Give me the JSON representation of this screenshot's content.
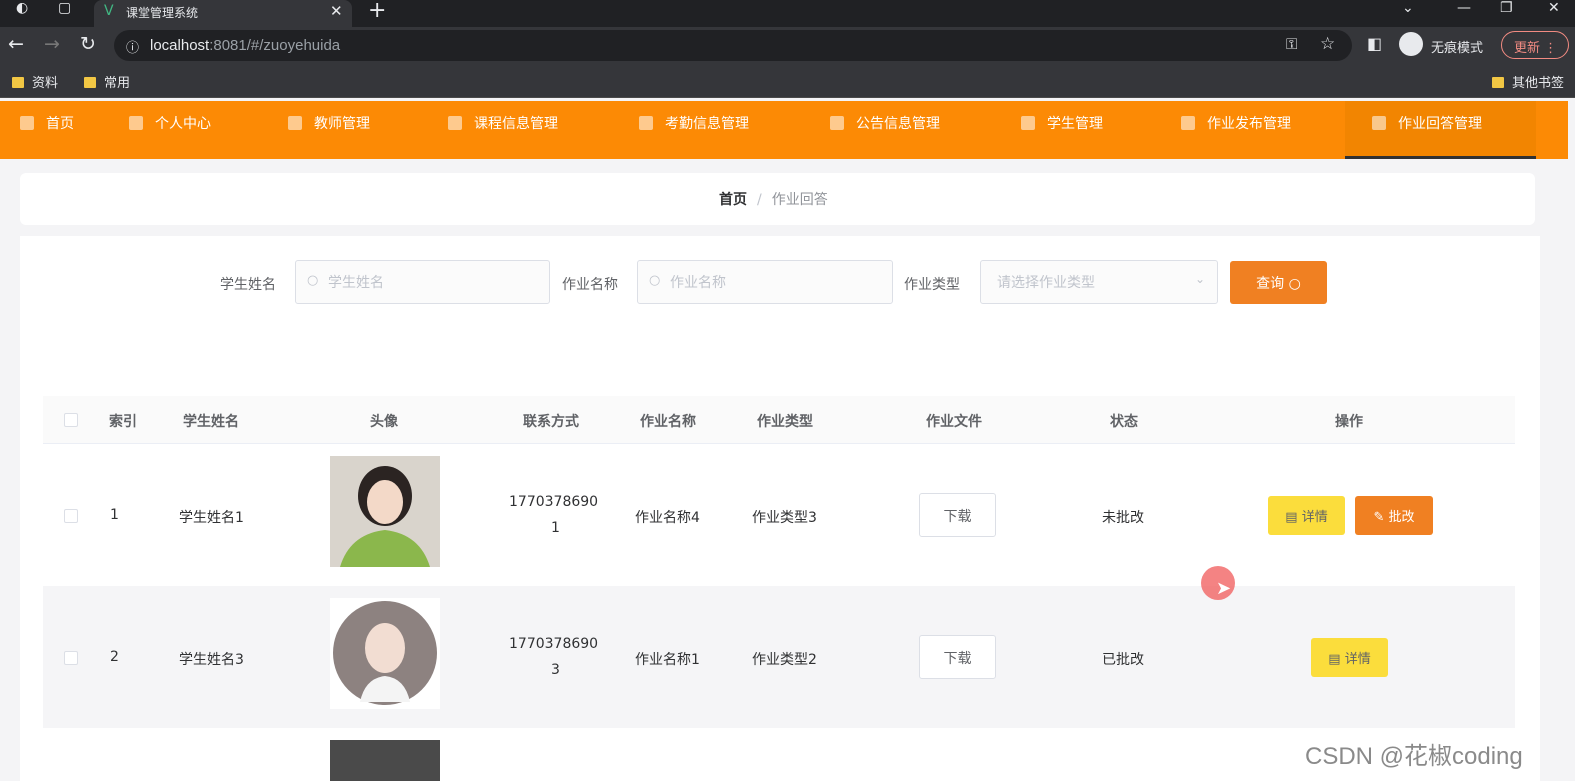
{
  "browser": {
    "tab_title": "课堂管理系统",
    "url_host": "localhost",
    "url_rest": ":8081/#/zuoyehuida",
    "incognito_label": "无痕模式",
    "update_label": "更新",
    "bookmarks": [
      "资料",
      "常用"
    ],
    "other_bookmarks": "其他书签"
  },
  "nav": {
    "items": [
      {
        "label": "首页",
        "icon": "home-icon"
      },
      {
        "label": "个人中心",
        "icon": "user-icon"
      },
      {
        "label": "教师管理",
        "icon": "menu-icon"
      },
      {
        "label": "课程信息管理",
        "icon": "flag-icon"
      },
      {
        "label": "考勤信息管理",
        "icon": "chat-icon"
      },
      {
        "label": "公告信息管理",
        "icon": "doc-icon"
      },
      {
        "label": "学生管理",
        "icon": "user-icon"
      },
      {
        "label": "作业发布管理",
        "icon": "grid-icon"
      },
      {
        "label": "作业回答管理",
        "icon": "doc-icon"
      }
    ],
    "active": "作业回答管理"
  },
  "breadcrumb": {
    "home": "首页",
    "separator": "/",
    "current": "作业回答"
  },
  "search": {
    "student_label": "学生姓名",
    "student_placeholder": "学生姓名",
    "hw_label": "作业名称",
    "hw_placeholder": "作业名称",
    "type_label": "作业类型",
    "type_placeholder": "请选择作业类型",
    "query_label": "查询"
  },
  "table": {
    "headers": [
      "索引",
      "学生姓名",
      "头像",
      "联系方式",
      "作业名称",
      "作业类型",
      "作业文件",
      "状态",
      "操作"
    ],
    "rows": [
      {
        "index": "1",
        "name": "学生姓名1",
        "phone1": "1770378690",
        "phone2": "1",
        "hw": "作业名称4",
        "type": "作业类型3",
        "file": "下载",
        "status": "未批改",
        "detail": "详情",
        "approve": "批改"
      },
      {
        "index": "2",
        "name": "学生姓名3",
        "phone1": "1770378690",
        "phone2": "3",
        "hw": "作业名称1",
        "type": "作业类型2",
        "file": "下载",
        "status": "已批改",
        "detail": "详情"
      }
    ]
  },
  "watermark": "CSDN @花椒coding",
  "colors": {
    "nav_bg": "#fc8a05",
    "primary_btn": "#f08022",
    "detail_btn": "#fbdd3c"
  }
}
